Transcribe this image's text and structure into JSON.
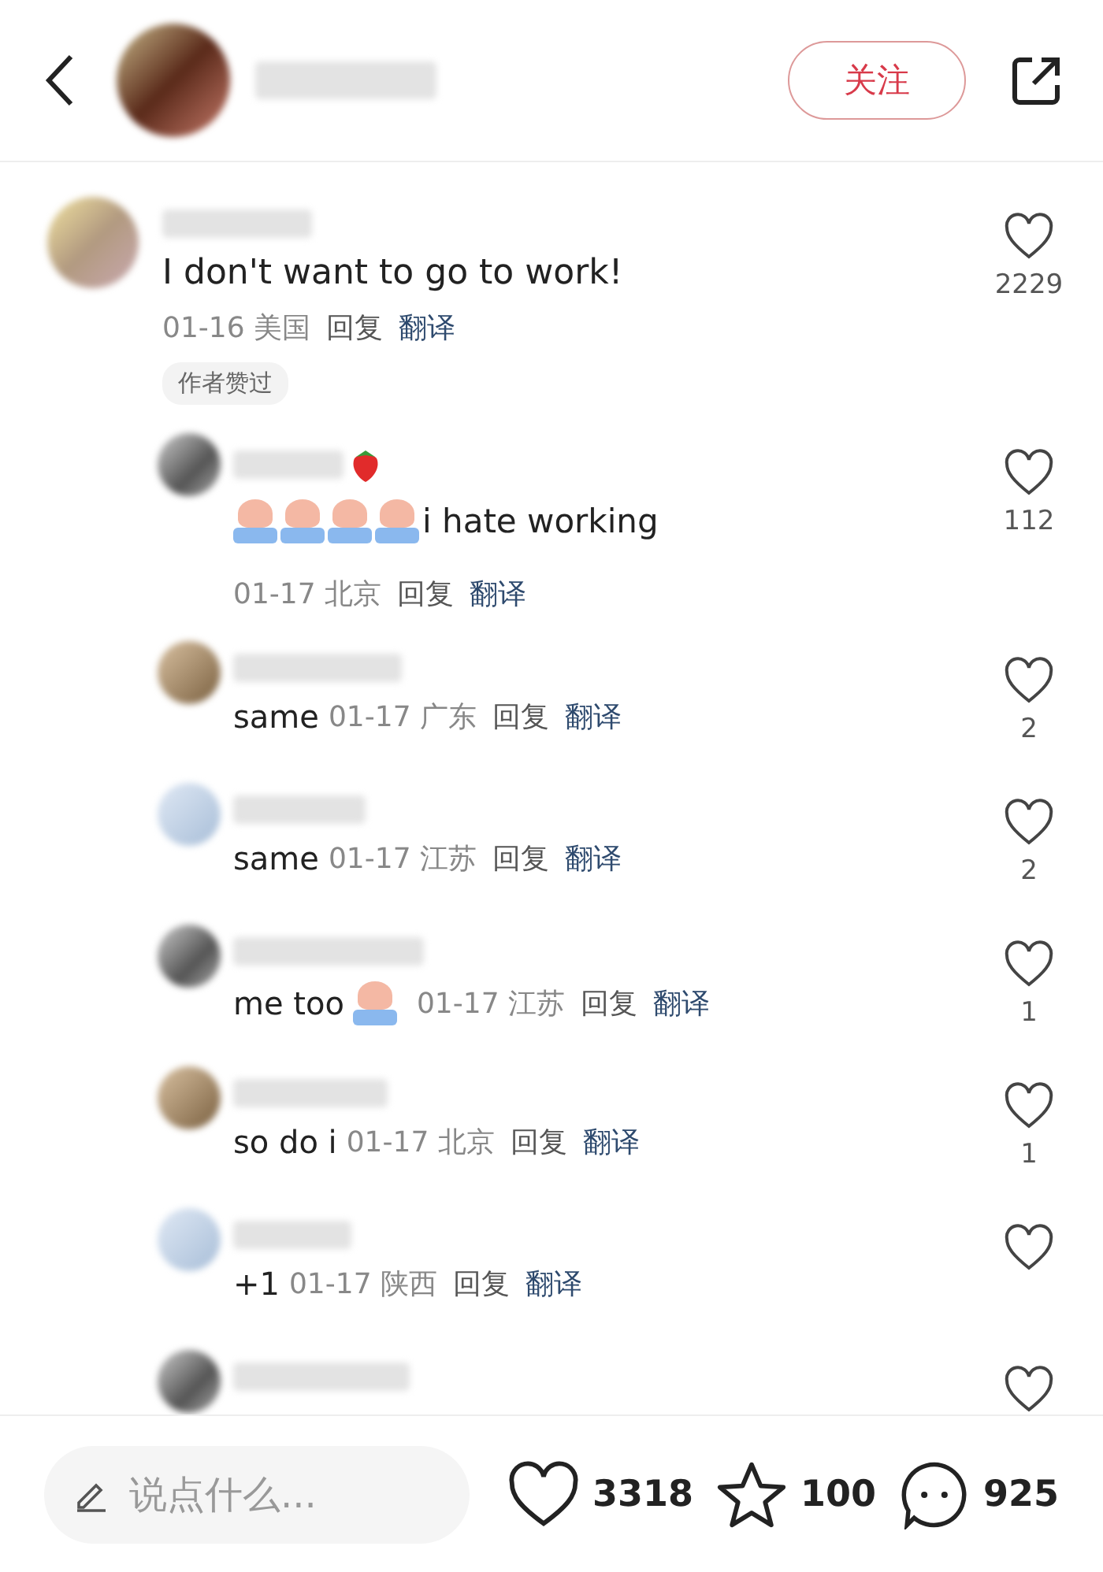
{
  "header": {
    "follow_button": "关注"
  },
  "comment": {
    "content": [
      {
        "kind": "text",
        "text": "I don't want to go to work!"
      }
    ],
    "date": "01-16",
    "location": "美国",
    "reply": "回复",
    "translate": "翻译",
    "likes": "2229",
    "author_liked_tag": "作者赞过"
  },
  "replies": [
    {
      "kind": "block",
      "strawberry_badge": true,
      "content": [
        {
          "kind": "sticker"
        },
        {
          "kind": "sticker"
        },
        {
          "kind": "sticker"
        },
        {
          "kind": "sticker"
        },
        {
          "kind": "text",
          "text": "i hate working"
        }
      ],
      "date": "01-17",
      "location": "北京",
      "reply": "回复",
      "translate": "翻译",
      "likes": "112"
    },
    {
      "kind": "inline",
      "strawberry_badge": false,
      "content": [
        {
          "kind": "text",
          "text": "same"
        }
      ],
      "date": "01-17",
      "location": "广东",
      "reply": "回复",
      "translate": "翻译",
      "likes": "2"
    },
    {
      "kind": "inline",
      "strawberry_badge": false,
      "content": [
        {
          "kind": "text",
          "text": "same"
        }
      ],
      "date": "01-17",
      "location": "江苏",
      "reply": "回复",
      "translate": "翻译",
      "likes": "2"
    },
    {
      "kind": "inline",
      "strawberry_badge": false,
      "content": [
        {
          "kind": "text",
          "text": "me too"
        },
        {
          "kind": "sticker"
        }
      ],
      "date": "01-17",
      "location": "江苏",
      "reply": "回复",
      "translate": "翻译",
      "likes": "1"
    },
    {
      "kind": "inline",
      "strawberry_badge": false,
      "content": [
        {
          "kind": "text",
          "text": "so do i"
        }
      ],
      "date": "01-17",
      "location": "北京",
      "reply": "回复",
      "translate": "翻译",
      "likes": "1"
    },
    {
      "kind": "inline",
      "strawberry_badge": false,
      "content": [
        {
          "kind": "text",
          "text": "+1"
        }
      ],
      "date": "01-17",
      "location": "陕西",
      "reply": "回复",
      "translate": "翻译"
    },
    {
      "kind": "partial"
    }
  ],
  "bottom_bar": {
    "placeholder": "说点什么...",
    "likes": "3318",
    "favorites": "100",
    "comments": "925"
  }
}
